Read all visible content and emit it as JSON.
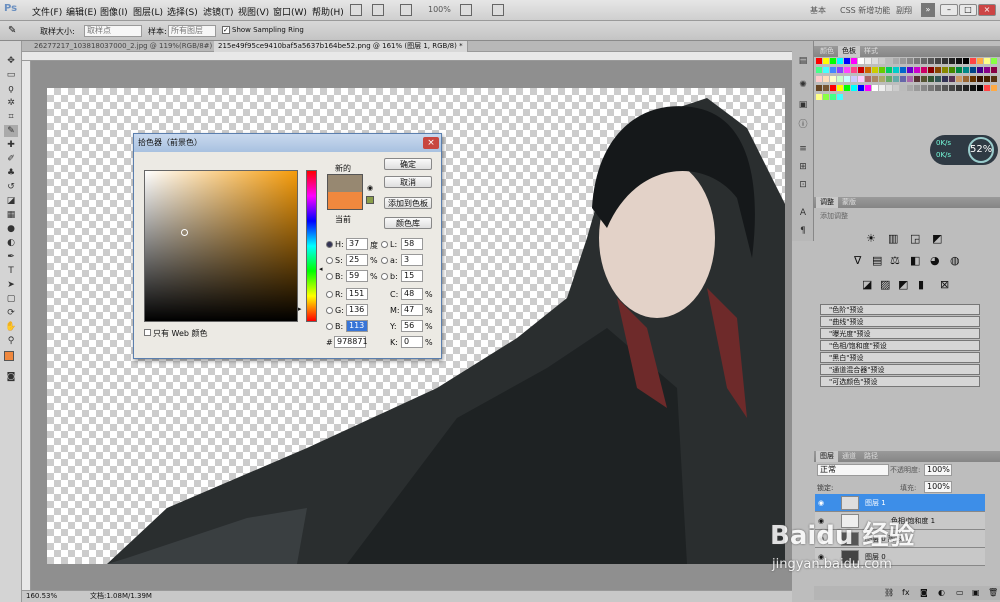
{
  "app": {
    "logo": "Ps"
  },
  "menu": [
    "文件(F)",
    "编辑(E)",
    "图像(I)",
    "图层(L)",
    "选择(S)",
    "滤镜(T)",
    "视图(V)",
    "窗口(W)",
    "帮助(H)"
  ],
  "menu_right": {
    "zoom": "100%",
    "workspace1": "基本",
    "workspace2": "CSS 新增功能",
    "workspace3": "副翔"
  },
  "options": {
    "sample_size_label": "取样大小:",
    "sample_size_value": "取样点",
    "sample_label": "样本:",
    "sample_value": "所有图层",
    "show_ring": "Show Sampling Ring"
  },
  "tabs": [
    {
      "label": "26277217_103818037000_2.jpg @ 119%(RGB/8#) *"
    },
    {
      "label": "215e49f95ce9410baf5a5637b164be52.png @ 161% (图层 1, RGB/8) *"
    }
  ],
  "status": {
    "zoom": "160.53%",
    "doc": "文档:1.08M/1.39M"
  },
  "picker": {
    "title": "拾色器（前景色）",
    "new_label": "新的",
    "current_label": "当前",
    "ok": "确定",
    "cancel": "取消",
    "add_swatch": "添加到色板",
    "libraries": "颜色库",
    "web_only": "只有 Web 颜色",
    "H": {
      "label": "H:",
      "value": "37",
      "unit": "度"
    },
    "S": {
      "label": "S:",
      "value": "25",
      "unit": "%"
    },
    "B": {
      "label": "B:",
      "value": "59",
      "unit": "%"
    },
    "R": {
      "label": "R:",
      "value": "151"
    },
    "G": {
      "label": "G:",
      "value": "136"
    },
    "Bl": {
      "label": "B:",
      "value": "113"
    },
    "L": {
      "label": "L:",
      "value": "58"
    },
    "a": {
      "label": "a:",
      "value": "3"
    },
    "b": {
      "label": "b:",
      "value": "15"
    },
    "C": {
      "label": "C:",
      "value": "48",
      "unit": "%"
    },
    "M": {
      "label": "M:",
      "value": "47",
      "unit": "%"
    },
    "Y": {
      "label": "Y:",
      "value": "56",
      "unit": "%"
    },
    "K": {
      "label": "K:",
      "value": "0",
      "unit": "%"
    },
    "hex_label": "#",
    "hex": "978871",
    "new_color": "#978871",
    "current_color": "#f0883e"
  },
  "panels": {
    "color_tabs": [
      "颜色",
      "色板",
      "样式"
    ],
    "adjust_tabs": [
      "调整",
      "蒙版"
    ],
    "adjust_hint": "添加调整",
    "presets": [
      "\"色阶\"预设",
      "\"曲线\"预设",
      "\"曝光度\"预设",
      "\"色相/饱和度\"预设",
      "\"黑白\"预设",
      "\"通道混合器\"预设",
      "\"可选颜色\"预设"
    ],
    "layer_tabs": [
      "图层",
      "通道",
      "路径"
    ],
    "blend_mode": "正常",
    "opacity_label": "不透明度:",
    "opacity": "100%",
    "fill_label": "填充:",
    "fill": "100%",
    "lock_label": "锁定:",
    "layers": [
      {
        "name": "图层 1",
        "selected": true
      },
      {
        "name": "色相/饱和度 1",
        "selected": false
      },
      {
        "name": "图层 0 副本",
        "selected": false
      },
      {
        "name": "图层 0",
        "selected": false
      }
    ]
  },
  "overlay": {
    "cpu": "52%",
    "net_up": "0K/s",
    "net_down": "0K/s"
  },
  "watermark": {
    "brand": "Baidu 经验",
    "url": "jingyan.baidu.com"
  }
}
